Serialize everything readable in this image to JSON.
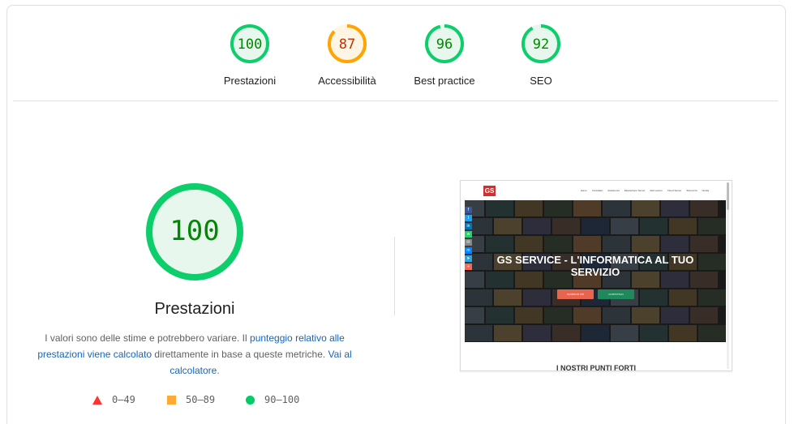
{
  "colors": {
    "pass": "#0cce6b",
    "average": "#ffa400",
    "fail": "#ff4e42",
    "pass_fill": "#e8f7ee",
    "average_fill": "#fff5e5",
    "link": "#1565c0"
  },
  "summary_gauges": [
    {
      "label": "Prestazioni",
      "score": "100",
      "value": 100,
      "rating": "pass"
    },
    {
      "label": "Accessibilità",
      "score": "87",
      "value": 87,
      "rating": "average"
    },
    {
      "label": "Best practice",
      "score": "96",
      "value": 96,
      "rating": "pass"
    },
    {
      "label": "SEO",
      "score": "92",
      "value": 92,
      "rating": "pass"
    }
  ],
  "main": {
    "score": "100",
    "value": 100,
    "title": "Prestazioni",
    "description": {
      "t1": "I valori sono delle stime e potrebbero variare. Il ",
      "link1": "punteggio relativo alle prestazioni viene calcolato",
      "t2": " direttamente in base a queste metriche. ",
      "link2": "Vai al calcolatore",
      "t3": "."
    }
  },
  "legend": [
    {
      "range": "0–49",
      "shape": "triangle",
      "rating": "fail"
    },
    {
      "range": "50–89",
      "shape": "square",
      "rating": "average"
    },
    {
      "range": "90–100",
      "shape": "circle",
      "rating": "pass"
    }
  ],
  "screenshot": {
    "logo": "GS",
    "menu": [
      "Home",
      "Contattaci",
      "Assistenza",
      "Riparazione Server",
      "Reti Lavoro",
      "Cloud Server",
      "Sicurezza",
      "Novità"
    ],
    "hero_title": "GS SERVICE - L'INFORMATICA AL TUO SERVIZIO",
    "buttons": [
      "SCOPRI DI PIÙ",
      "CONTATTACI"
    ],
    "social_icons": [
      "facebook-icon",
      "twitter-icon",
      "linkedin-icon",
      "whatsapp-icon",
      "email-icon",
      "messenger-icon",
      "telegram-icon",
      "more-icon"
    ],
    "section_title": "I NOSTRI PUNTI FORTI"
  }
}
